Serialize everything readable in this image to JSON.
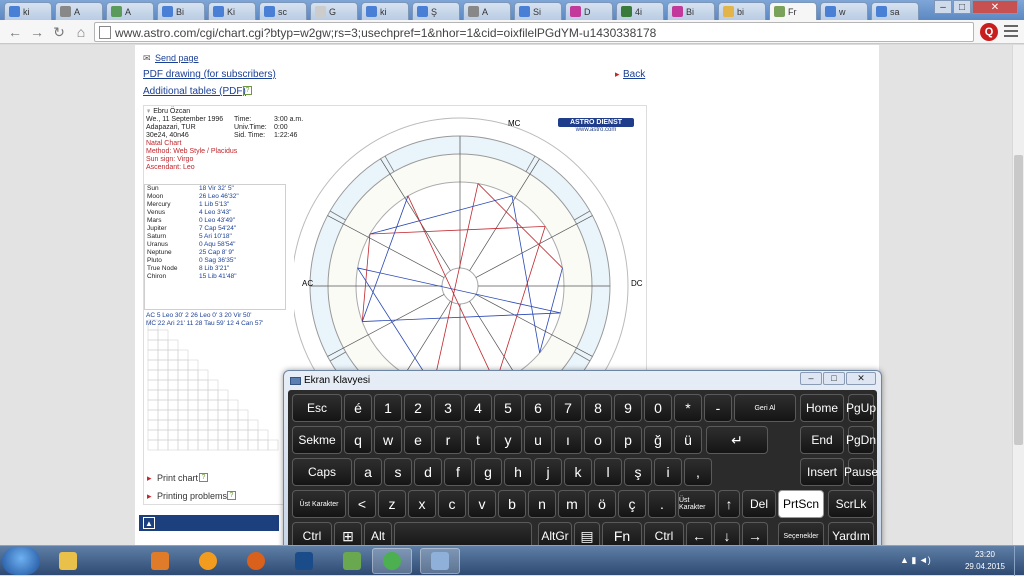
{
  "tabs": [
    {
      "label": "ki",
      "icon": "google-icon",
      "color": "#4a7fd6"
    },
    {
      "label": "A",
      "icon": "wikipedia-icon",
      "color": "#888888"
    },
    {
      "label": "A",
      "icon": "site-icon",
      "color": "#5a9a5a"
    },
    {
      "label": "Bi",
      "icon": "google-icon",
      "color": "#4a7fd6"
    },
    {
      "label": "Ki",
      "icon": "google-icon",
      "color": "#4a7fd6"
    },
    {
      "label": "sc",
      "icon": "google-icon",
      "color": "#4a7fd6"
    },
    {
      "label": "G",
      "icon": "page-icon",
      "color": "#cccccc"
    },
    {
      "label": "ki",
      "icon": "google-icon",
      "color": "#4a7fd6"
    },
    {
      "label": "Ş",
      "icon": "google-icon",
      "color": "#4a7fd6"
    },
    {
      "label": "A",
      "icon": "wikipedia-icon",
      "color": "#888888"
    },
    {
      "label": "Si",
      "icon": "google-icon",
      "color": "#4a7fd6"
    },
    {
      "label": "D",
      "icon": "site-icon",
      "color": "#c2389b"
    },
    {
      "label": "4i",
      "icon": "site-icon",
      "color": "#3a7a3a"
    },
    {
      "label": "Bi",
      "icon": "site-icon",
      "color": "#c2389b"
    },
    {
      "label": "bi",
      "icon": "site-icon",
      "color": "#e2b44a"
    },
    {
      "label": "Fr",
      "icon": "site-icon",
      "color": "#7aa25a",
      "active": true
    },
    {
      "label": "w",
      "icon": "google-icon",
      "color": "#4a7fd6"
    },
    {
      "label": "sa",
      "icon": "google-icon",
      "color": "#4a7fd6"
    }
  ],
  "address": {
    "url": "www.astro.com/cgi/chart.cgi?btyp=w2gw;rs=3;usechpref=1&nhor=1&cid=oixfilelPGdYM-u1430338178"
  },
  "page": {
    "send_page": "Send page",
    "pdf_drawing": "PDF drawing (for subscribers)",
    "additional_tables": "Additional tables (PDF)",
    "back": "Back",
    "print_chart": "Print chart",
    "printing_problems": "Printing problems"
  },
  "chart_info": {
    "name": "Ebru Özcan",
    "date": "We., 11 September 1996",
    "place": "Adapazari, TUR",
    "coords": "30e24, 40n46",
    "time_label": "Time:",
    "time": "3:00 a.m.",
    "univ_label": "Univ.Time:",
    "univ": "0:00",
    "sid_label": "Sid. Time:",
    "sid": "1:22:46",
    "natal": "Natal Chart",
    "method": "Method: Web Style / Placidus",
    "sun_sign": "Sun sign: Virgo",
    "ascendant": "Ascendant: Leo"
  },
  "planets": [
    {
      "name": "Sun",
      "pos": "18 Vir 32' 5\""
    },
    {
      "name": "Moon",
      "pos": "26 Leo 46'32\""
    },
    {
      "name": "Mercury",
      "pos": "1 Lib 5'13\""
    },
    {
      "name": "Venus",
      "pos": "4 Leo 3'43\""
    },
    {
      "name": "Mars",
      "pos": "0 Leo 43'49\""
    },
    {
      "name": "Jupiter",
      "pos": "7 Cap 54'24\""
    },
    {
      "name": "Saturn",
      "pos": "5 Ari 10'18\""
    },
    {
      "name": "Uranus",
      "pos": "0 Aqu 58'54\""
    },
    {
      "name": "Neptune",
      "pos": "25 Cap 8' 9\""
    },
    {
      "name": "Pluto",
      "pos": "0 Sag 36'35\""
    },
    {
      "name": "True Node",
      "pos": "8 Lib 3'21\""
    },
    {
      "name": "Chiron",
      "pos": "15 Lib 41'48\""
    }
  ],
  "houses_line1": "AC  5 Leo 30'   2  26 Leo  0'   3  20 Vir 50'",
  "houses_line2": "MC 22 Ari 21' 11  28 Tau 59' 12   4 Can 57'",
  "wheel_labels": {
    "mc": "MC",
    "ac": "AC",
    "dc": "DC",
    "logo": "ASTRO DIENST",
    "logo_url": "www.astro.com"
  },
  "keyboard": {
    "title": "Ekran Klavyesi",
    "rows": [
      [
        "Esc",
        "é",
        "1",
        "2",
        "3",
        "4",
        "5",
        "6",
        "7",
        "8",
        "9",
        "0",
        "*",
        "-",
        "Geri Al",
        "Home",
        "PgUp"
      ],
      [
        "Sekme",
        "q",
        "w",
        "e",
        "r",
        "t",
        "y",
        "u",
        "ı",
        "o",
        "p",
        "ğ",
        "ü",
        "↵",
        "End",
        "PgDn"
      ],
      [
        "Caps",
        "a",
        "s",
        "d",
        "f",
        "g",
        "h",
        "j",
        "k",
        "l",
        "ş",
        "i",
        ",",
        "Insert",
        "Pause"
      ],
      [
        "Üst Karakter",
        "<",
        "z",
        "x",
        "c",
        "v",
        "b",
        "n",
        "m",
        "ö",
        "ç",
        ".",
        "Üst Karakter",
        "↑",
        "Del",
        "PrtScn",
        "ScrLk"
      ],
      [
        "Ctrl",
        "⊞",
        "Alt",
        "",
        "AltGr",
        "▤",
        "Fn",
        "Ctrl",
        "←",
        "↓",
        "→",
        "Seçenekler",
        "Yardım"
      ]
    ]
  },
  "taskbar": {
    "time": "23:20",
    "date": "29.04.2015"
  }
}
